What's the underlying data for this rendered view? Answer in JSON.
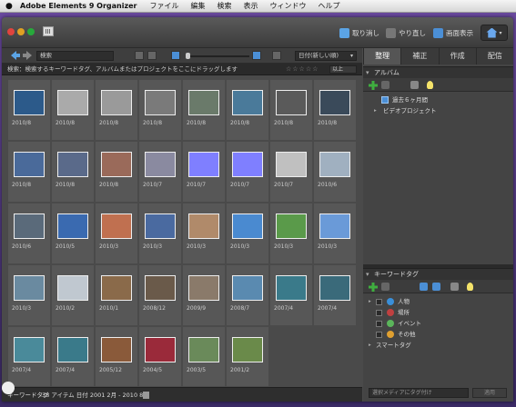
{
  "menubar": {
    "apple": "",
    "app_name": "Adobe Elements 9 Organizer",
    "items": [
      "ファイル",
      "編集",
      "検索",
      "表示",
      "ウィンドウ",
      "ヘルプ"
    ]
  },
  "toolbar": {
    "undo_label": "取り消し",
    "redo_label": "やり直し",
    "screen_label": "画面表示"
  },
  "media_toolbar": {
    "search_text": "検索",
    "sort_value": "日付(新しい順)"
  },
  "hint_bar": {
    "text": "検索：検索するキーワードタグ、アルバムまたはプロジェクトをここにドラッグします",
    "stars": "☆☆☆☆☆",
    "rating": "以上"
  },
  "grid": {
    "items": [
      {
        "date": "2010/8",
        "color": "#2c5a8a"
      },
      {
        "date": "2010/8",
        "color": "#aaaaaa"
      },
      {
        "date": "2010/8",
        "color": "#9a9a9a"
      },
      {
        "date": "2010/8",
        "color": "#7a7a7a"
      },
      {
        "date": "2010/8",
        "color": "#6a7a6a"
      },
      {
        "date": "2010/8",
        "color": "#4a7a9a"
      },
      {
        "date": "2010/8",
        "color": "#5a5a5a"
      },
      {
        "date": "2010/8",
        "color": "#3a4a5a"
      },
      {
        "date": "2010/8",
        "color": "#4a6a9a"
      },
      {
        "date": "2010/8",
        "color": "#5a6a8a"
      },
      {
        "date": "2010/8",
        "color": "#9a6a5a"
      },
      {
        "date": "2010/7",
        "color": "#8a8aa0"
      },
      {
        "date": "2010/7",
        "color": "#7f7fff"
      },
      {
        "date": "2010/7",
        "color": "#7f7fff"
      },
      {
        "date": "2010/7",
        "color": "#c0c0c0"
      },
      {
        "date": "2010/6",
        "color": "#a0b0c0"
      },
      {
        "date": "2010/6",
        "color": "#5a6a7a"
      },
      {
        "date": "2010/5",
        "color": "#3a6ab0"
      },
      {
        "date": "2010/3",
        "color": "#c07050"
      },
      {
        "date": "2010/3",
        "color": "#4a6aa0"
      },
      {
        "date": "2010/3",
        "color": "#b08a6a"
      },
      {
        "date": "2010/3",
        "color": "#4a8ad0"
      },
      {
        "date": "2010/3",
        "color": "#5a9a4a"
      },
      {
        "date": "2010/3",
        "color": "#6a9ad8"
      },
      {
        "date": "2010/3",
        "color": "#6a8aa0"
      },
      {
        "date": "2010/2",
        "color": "#c0c8d0"
      },
      {
        "date": "2010/1",
        "color": "#8a6a4a"
      },
      {
        "date": "2008/12",
        "color": "#6a5a4a"
      },
      {
        "date": "2009/9",
        "color": "#8a7a6a"
      },
      {
        "date": "2008/7",
        "color": "#5a8ab0"
      },
      {
        "date": "2007/4",
        "color": "#3a7a8a"
      },
      {
        "date": "2007/4",
        "color": "#3a6a7a"
      },
      {
        "date": "2007/4",
        "color": "#4a8a9a"
      },
      {
        "date": "2007/4",
        "color": "#3a7a8a"
      },
      {
        "date": "2005/12",
        "color": "#8a5a3a"
      },
      {
        "date": "2004/5",
        "color": "#9a2a3a"
      },
      {
        "date": "2003/5",
        "color": "#6a8a5a"
      },
      {
        "date": "2001/2",
        "color": "#6a8a4a"
      }
    ]
  },
  "status_bar": {
    "keyword_label": "キーワードタグ",
    "count_text": "38 アイテム 日付 2001 2月 - 2010 8月"
  },
  "right_panel": {
    "tabs": [
      {
        "label": "整理",
        "active": true
      },
      {
        "label": "補正",
        "active": false
      },
      {
        "label": "作成",
        "active": false
      },
      {
        "label": "配信",
        "active": false
      }
    ],
    "albums": {
      "title": "アルバム",
      "items": [
        "過去６ヶ月間",
        "ビデオプロジェクト"
      ]
    },
    "keywords": {
      "title": "キーワードタグ",
      "items": [
        "人物",
        "場所",
        "イベント",
        "その他"
      ],
      "smart_tag": "スマートタグ"
    },
    "tag_input_placeholder": "選択メディアにタグ付け",
    "apply_label": "適用"
  }
}
